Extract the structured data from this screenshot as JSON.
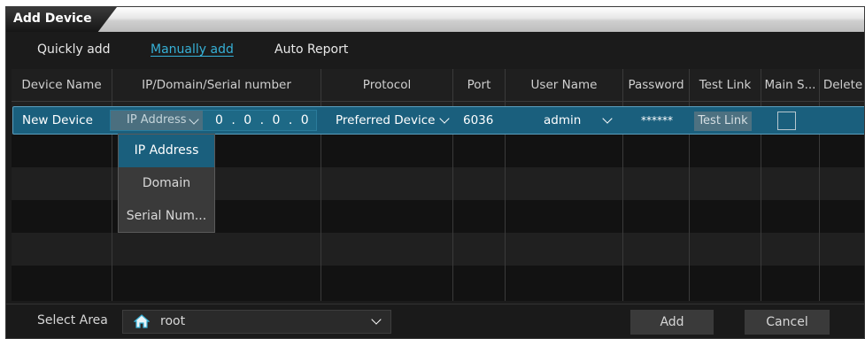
{
  "window": {
    "title": "Add Device"
  },
  "tabs": [
    {
      "label": "Quickly add",
      "active": false
    },
    {
      "label": "Manually add",
      "active": true
    },
    {
      "label": "Auto Report",
      "active": false
    }
  ],
  "table": {
    "columns": [
      "Device Name",
      "IP/Domain/Serial number",
      "Protocol",
      "Port",
      "User Name",
      "Password",
      "Test Link",
      "Main S...",
      "Delete"
    ],
    "row": {
      "device_name": "New Device",
      "address_type": "IP Address",
      "ip_octets": "0 . 0 . 0 . 0",
      "protocol": "Preferred Device",
      "port": "6036",
      "user_name": "admin",
      "password": "******",
      "test_link_button": "Test Link",
      "main_stream_checked": false
    },
    "address_type_options": [
      "IP Address",
      "Domain",
      "Serial Num..."
    ]
  },
  "footer": {
    "select_area_label": "Select Area",
    "area_value": "root",
    "add_button": "Add",
    "cancel_button": "Cancel"
  },
  "colors": {
    "accent": "#36b0d6",
    "selection": "#1a5f7d",
    "background": "#1b1b1b"
  }
}
